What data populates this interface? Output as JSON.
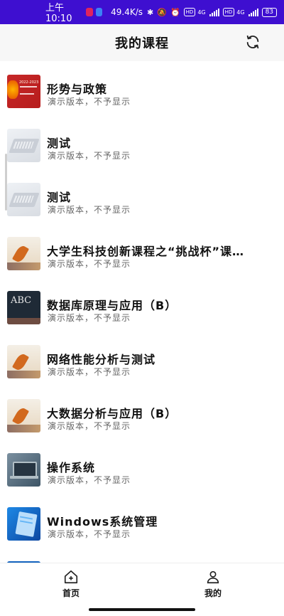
{
  "status_bar": {
    "time": "上午10:10",
    "network_speed": "49.4K/s",
    "network_gen_1": "4G",
    "network_gen_2": "4G",
    "hd_1": "HD",
    "hd_2": "HD",
    "battery": "83",
    "icons": [
      "app-notification-icon",
      "app-notification-icon",
      "bluetooth-icon",
      "mute-icon",
      "alarm-icon",
      "signal-icon",
      "signal-icon",
      "battery-icon"
    ]
  },
  "header": {
    "title": "我的课程",
    "refresh_icon": "refresh-icon"
  },
  "courses": [
    {
      "title": "形势与政策",
      "subtitle": "演示版本，不予显示",
      "thumb": "red-cover"
    },
    {
      "title": "测试",
      "subtitle": "演示版本，不予显示",
      "thumb": "laptop"
    },
    {
      "title": "测试",
      "subtitle": "演示版本，不予显示",
      "thumb": "laptop"
    },
    {
      "title": "大学生科技创新课程之“挑战杯”课…",
      "subtitle": "演示版本，不予显示",
      "thumb": "autumn-leaf"
    },
    {
      "title": "数据库原理与应用（B）",
      "subtitle": "演示版本，不予显示",
      "thumb": "chalkboard-abc"
    },
    {
      "title": "网络性能分析与测试",
      "subtitle": "演示版本，不予显示",
      "thumb": "autumn-leaf"
    },
    {
      "title": "大数据分析与应用（B）",
      "subtitle": "演示版本，不予显示",
      "thumb": "autumn-leaf"
    },
    {
      "title": "操作系统",
      "subtitle": "演示版本，不予显示",
      "thumb": "laptop-desk"
    },
    {
      "title": "Windows系统管理",
      "subtitle": "演示版本，不予显示",
      "thumb": "blue-notebook"
    }
  ],
  "thumb_text": {
    "red_cover_line1": "2022-2023",
    "abc": "ABC"
  },
  "bottom_nav": {
    "home_label": "首页",
    "mine_label": "我的"
  },
  "colors": {
    "status_bar": "#3e0fd0",
    "header_bg": "#f7f7f7",
    "subtitle": "#666666"
  }
}
